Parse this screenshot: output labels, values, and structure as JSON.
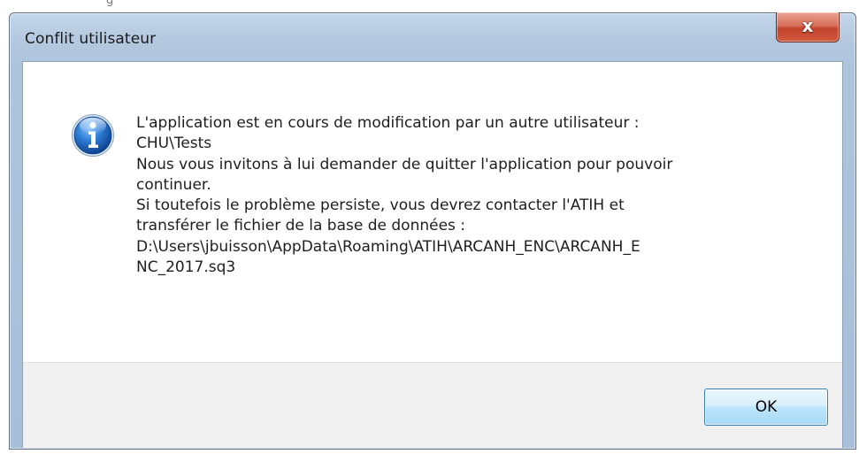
{
  "window": {
    "title": "Conflit utilisateur",
    "close_glyph": "x"
  },
  "icon": {
    "name": "information-icon",
    "glyph": "i",
    "color": "#1c5fb4"
  },
  "message": {
    "lines": [
      "L'application est en cours de modification par un autre utilisateur :",
      "CHU\\Tests",
      "Nous vous invitons à lui demander de quitter l'application pour pouvoir",
      "continuer.",
      "Si toutefois le problème persiste, vous devrez contacter l'ATIH et",
      "transférer le fichier de la base de données :",
      "D:\\Users\\jbuisson\\AppData\\Roaming\\ATIH\\ARCANH_ENC\\ARCANH_E",
      "NC_2017.sq3"
    ]
  },
  "buttons": {
    "ok_label": "OK"
  },
  "background": {
    "partial_text": "g"
  }
}
